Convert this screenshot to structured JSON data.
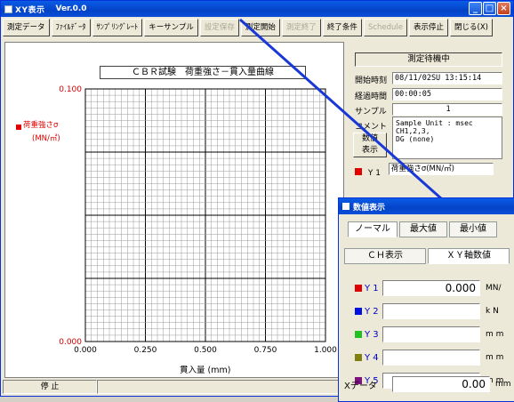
{
  "window": {
    "title": "XY表示",
    "version": "Ver.0.0"
  },
  "toolbar": [
    {
      "label": "測定データ",
      "enabled": true
    },
    {
      "label": "ﾌｧｲﾙﾃﾞｰﾀ",
      "enabled": true
    },
    {
      "label": "ｻﾝﾌﾟﾘﾝｸﾞﾚｰﾄ",
      "enabled": true
    },
    {
      "label": "キーサンプル",
      "enabled": true
    },
    {
      "label": "設定保存",
      "enabled": false
    },
    {
      "label": "測定開始",
      "enabled": true
    },
    {
      "label": "測定終了",
      "enabled": false
    },
    {
      "label": "終了条件",
      "enabled": true
    },
    {
      "label": "Schedule",
      "enabled": false
    },
    {
      "label": "表示停止",
      "enabled": true
    },
    {
      "label": "閉じる(X)",
      "enabled": true
    }
  ],
  "chart_data": {
    "type": "line",
    "title": "ＣＢＲ試験　荷重強さ－貫入量曲線",
    "xlabel": "貫入量 (mm)",
    "xlim": [
      0.0,
      1.0
    ],
    "ylim": [
      0.0,
      0.1
    ],
    "x_ticks": [
      "0.000",
      "0.250",
      "0.500",
      "0.750",
      "1.000"
    ],
    "y_ticks": [
      "0.000",
      "0.100"
    ],
    "grid": true,
    "series": [
      {
        "name": "荷重強さσ",
        "unit": "(MN/㎡)",
        "color": "#e00000",
        "values": []
      }
    ]
  },
  "status_bar": {
    "state": "停 止"
  },
  "panel": {
    "status": "測定待機中",
    "start_label": "開始時刻",
    "start_value": "08/11/02SU 13:15:14",
    "elapsed_label": "経過時間",
    "elapsed_value": "00:00:05",
    "sample_label": "サンプル",
    "sample_value": "1",
    "comment_label": "コメント",
    "comment_value": "Sample Unit : msec\nCH1,2,3,\nDG (none)",
    "numeric_button": "数値\n表示",
    "y1_label": "Y 1",
    "y1_value": "荷重強さσ(MN/㎡)"
  },
  "dialog": {
    "title": "数値表示",
    "mode_tabs": [
      "ノーマル",
      "最大値",
      "最小値"
    ],
    "view_tabs": [
      "ＣＨ表示",
      "ＸＹ軸数値"
    ],
    "rows": [
      {
        "label": "Y 1",
        "value": "0.000",
        "unit": "MN/",
        "color": "#e00000"
      },
      {
        "label": "Y 2",
        "value": "",
        "unit": "k N",
        "color": "#0010e0"
      },
      {
        "label": "Y 3",
        "value": "",
        "unit": "m m",
        "color": "#20c020"
      },
      {
        "label": "Y 4",
        "value": "",
        "unit": "m m",
        "color": "#808010"
      },
      {
        "label": "Y 5",
        "value": "",
        "unit": "m m",
        "color": "#801080"
      }
    ],
    "x_label": "Xデータ",
    "x_value": "0.00",
    "x_unit": "mm"
  }
}
